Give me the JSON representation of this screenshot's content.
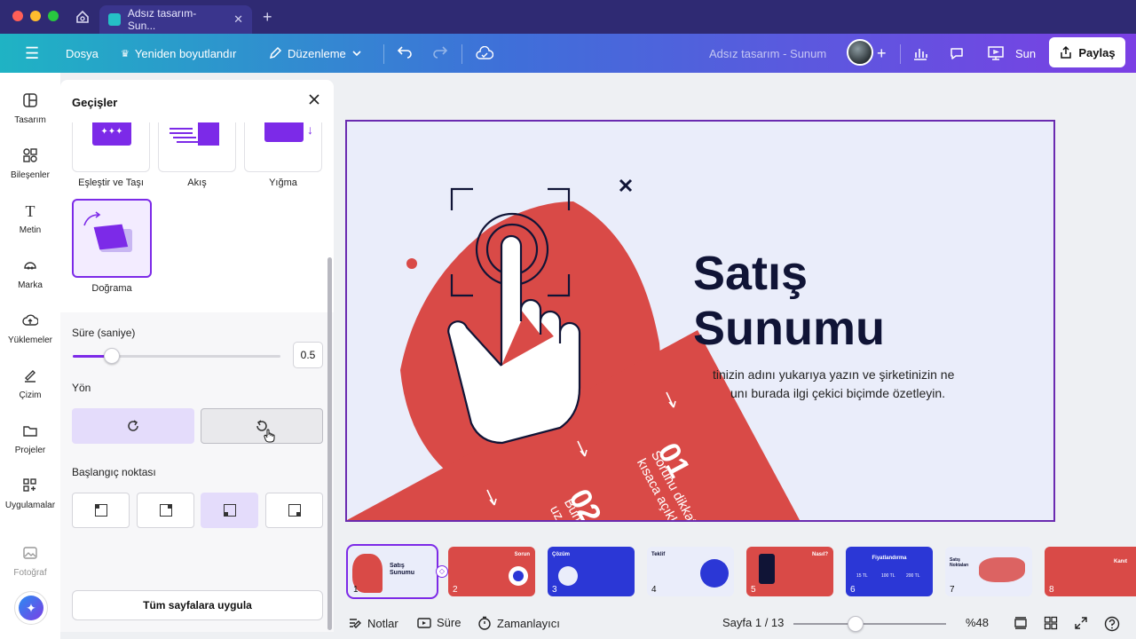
{
  "browser": {
    "tab_title": "Adsız tasarım- Sun...",
    "close_glyph": "✕",
    "new_tab_glyph": "+"
  },
  "toolbar": {
    "menu_glyph": "☰",
    "file_label": "Dosya",
    "resize_label": "Yeniden boyutlandır",
    "edit_label": "Düzenleme",
    "doc_title": "Adsız tasarım - Sunum",
    "present_label": "Sun",
    "share_label": "Paylaş",
    "gradient": [
      "#1fb3c4",
      "#3f6fd9",
      "#7b3fe4"
    ]
  },
  "rail": {
    "items": [
      {
        "label": "Tasarım",
        "icon": "layout-icon"
      },
      {
        "label": "Bileşenler",
        "icon": "shapes-icon"
      },
      {
        "label": "Metin",
        "icon": "text-icon"
      },
      {
        "label": "Marka",
        "icon": "brand-icon"
      },
      {
        "label": "Yüklemeler",
        "icon": "upload-icon"
      },
      {
        "label": "Çizim",
        "icon": "draw-icon"
      },
      {
        "label": "Projeler",
        "icon": "folder-icon"
      },
      {
        "label": "Uygulamalar",
        "icon": "apps-icon"
      },
      {
        "label": "Fotoğraf",
        "icon": "photo-icon"
      }
    ]
  },
  "panel": {
    "title": "Geçişler",
    "transitions": [
      {
        "label": "Eşleştir ve Taşı"
      },
      {
        "label": "Akış"
      },
      {
        "label": "Yığma"
      },
      {
        "label": "Doğrama",
        "selected": true
      }
    ],
    "duration_label": "Süre (saniye)",
    "duration_value": "0.5",
    "duration_fraction": 0.19,
    "direction_label": "Yön",
    "direction_active": "clockwise",
    "start_point_label": "Başlangıç noktası",
    "start_point_active_index": 2,
    "apply_label": "Tüm sayfalara uygula",
    "accent": "#7c2ae8"
  },
  "slide": {
    "title_line1": "Satış",
    "title_line2": "Sunumu",
    "body_line1": "tinizin adını yukarıya yazın ve şirketinizin ne",
    "body_line2": "unı burada ilgi çekici biçimde özetleyin.",
    "num1": "01",
    "num2": "02",
    "strip_text1": "Sorunu dikkat",
    "strip_text2": "kısaca açıkla",
    "strip_text3": "Bun",
    "strip_text4": "uz",
    "red": "#d94a47",
    "navy": "#101436"
  },
  "film": {
    "pages": [
      {
        "num": "1",
        "title": "Satış Sunumu"
      },
      {
        "num": "2",
        "title": "Sorun"
      },
      {
        "num": "3",
        "title": "Çözüm"
      },
      {
        "num": "4",
        "title": "Teklif"
      },
      {
        "num": "5",
        "title": "Nasıl?"
      },
      {
        "num": "6",
        "title": "Fiyatlandırma",
        "prices": [
          "15 TL",
          "100 TL",
          "200 TL"
        ]
      },
      {
        "num": "7",
        "title": "Satış Noktaları"
      },
      {
        "num": "8",
        "title": "Kanıt"
      }
    ]
  },
  "bottom": {
    "notes_label": "Notlar",
    "duration_label": "Süre",
    "timer_label": "Zamanlayıcı",
    "page_label": "Sayfa 1 / 13",
    "zoom_label": "%48",
    "zoom_fraction": 0.36
  }
}
